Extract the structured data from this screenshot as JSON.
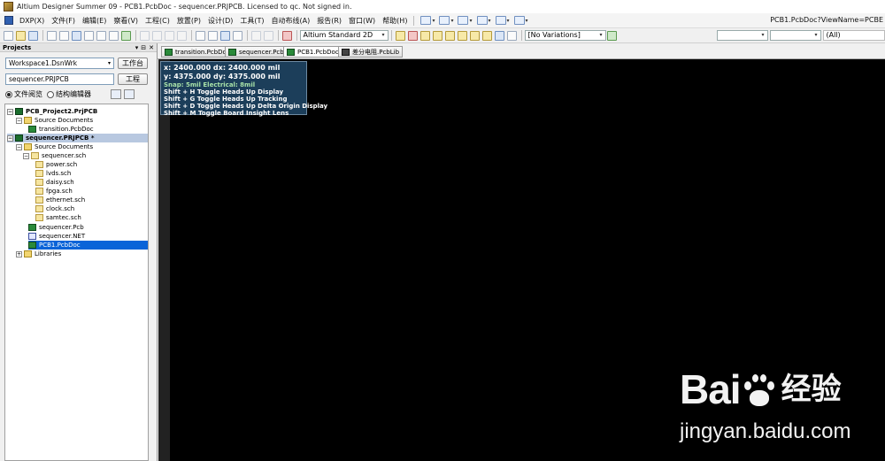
{
  "window": {
    "title": "Altium Designer Summer 09 - PCB1.PcbDoc - sequencer.PRJPCB. Licensed to qc. Not signed in.",
    "view_name": "PCB1.PcbDoc?ViewName=PCBE"
  },
  "menu": {
    "items": [
      "DXP(X)",
      "文件(F)",
      "编辑(E)",
      "察看(V)",
      "工程(C)",
      "放置(P)",
      "设计(D)",
      "工具(T)",
      "自动布线(A)",
      "报告(R)",
      "窗口(W)",
      "帮助(H)"
    ]
  },
  "toolbar": {
    "layer_set": "Altium Standard 2D",
    "variations": "[No Variations]",
    "filter_right": "(All)"
  },
  "projects_panel": {
    "title": "Projects",
    "workspace": "Workspace1.DsnWrk",
    "workspace_button": "工作台",
    "project": "sequencer.PRJPCB",
    "project_button": "工程",
    "view_file": "文件阅览",
    "view_struct": "结构编辑器",
    "tree": {
      "proj1": "PCB_Project2.PrjPCB",
      "proj1_src": "Source Documents",
      "proj1_doc": "transition.PcbDoc",
      "proj2": "sequencer.PRJPCB *",
      "proj2_src": "Source Documents",
      "sch_root": "sequencer.sch",
      "schs": [
        "power.sch",
        "lvds.sch",
        "daisy.sch",
        "fpga.sch",
        "ethernet.sch",
        "clock.sch",
        "samtec.sch"
      ],
      "pcb": "sequencer.Pcb",
      "net": "sequencer.NET",
      "pcb1": "PCB1.PcbDoc",
      "libraries": "Libraries"
    }
  },
  "tabs": [
    "transition.PcbDoc",
    "sequencer.Pcb",
    "PCB1.PcbDoc",
    "差分电阻.PcbLib"
  ],
  "hud": {
    "x": "x:  2400.000   dx:  2400.000 mil",
    "y": "y:  4375.000   dy:  4375.000 mil",
    "snap": "Snap: 5mil Electrical: 8mil",
    "help": [
      "Shift + H  Toggle Heads Up Display",
      "Shift + G  Toggle Heads Up Tracking",
      "Shift + D  Toggle Heads Up Delta Origin Display",
      "Shift + M  Toggle Board Insight Lens"
    ]
  },
  "watermark": {
    "brand_left": "Bai",
    "brand_right": "经验",
    "url": "jingyan.baidu.com"
  }
}
